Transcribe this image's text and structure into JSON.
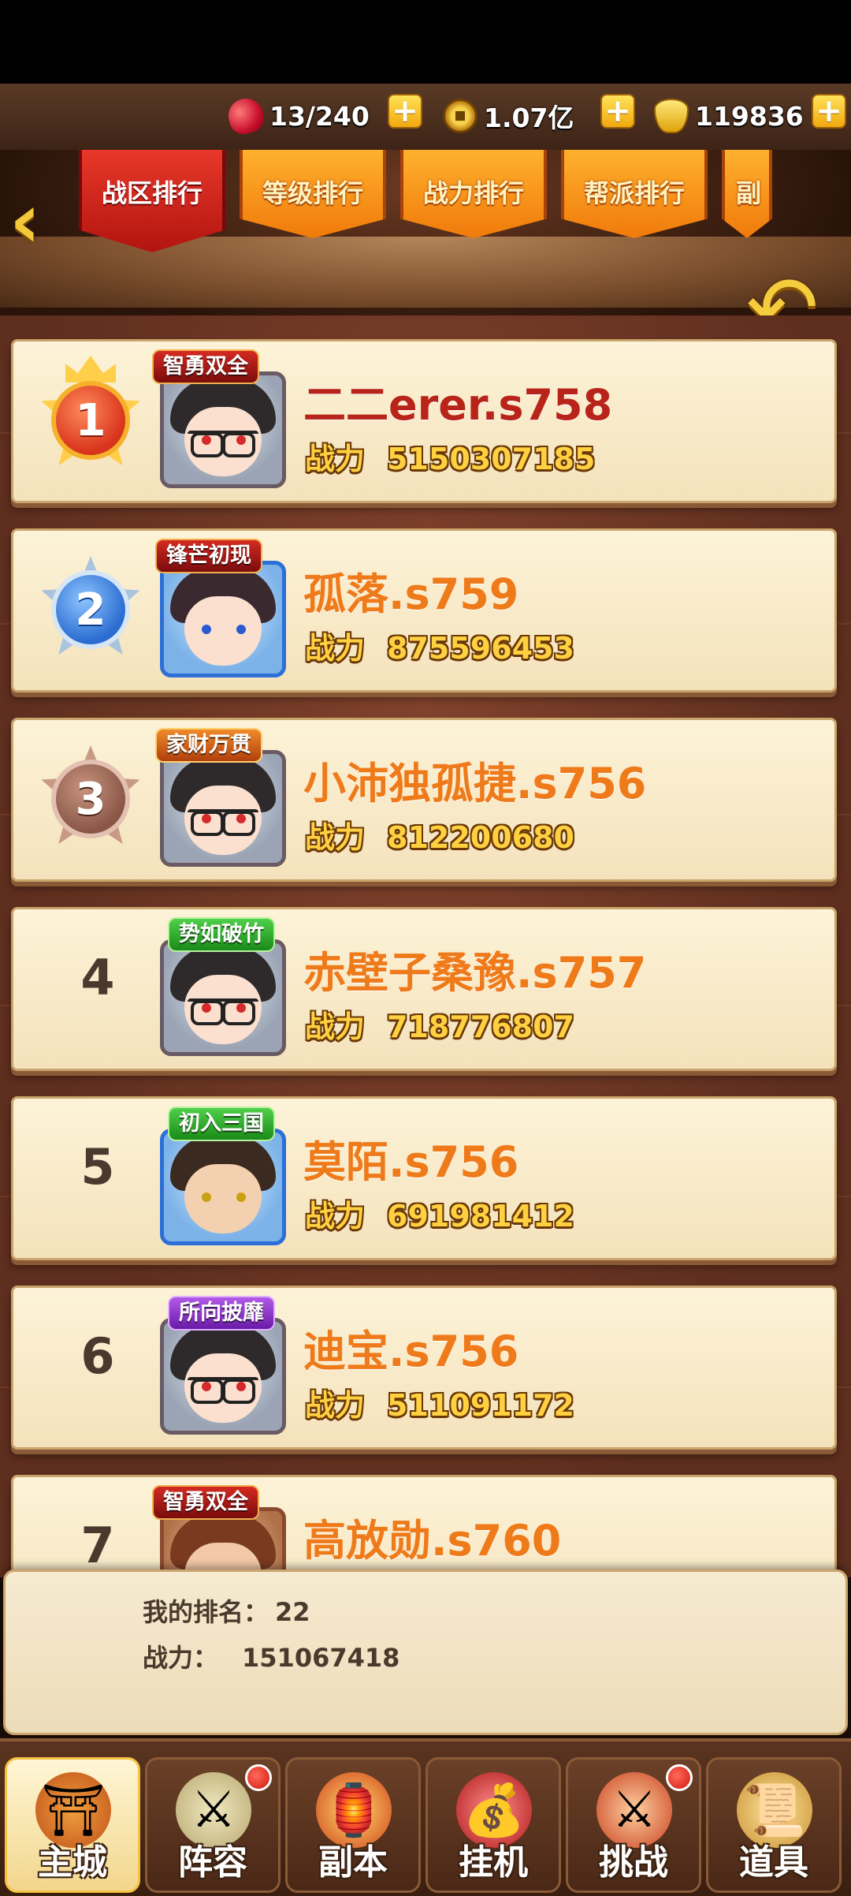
{
  "resources": {
    "stamina": "13/240",
    "copper": "1.07亿",
    "ingot": "119836"
  },
  "tabs": [
    {
      "label": "战区排行",
      "active": true
    },
    {
      "label": "等级排行",
      "active": false
    },
    {
      "label": "战力排行",
      "active": false
    },
    {
      "label": "帮派排行",
      "active": false
    },
    {
      "label": "副",
      "active": false
    }
  ],
  "power_label": "战力",
  "rankings": [
    {
      "rank": "1",
      "title": "智勇双全",
      "name": "二二erer.s758",
      "power": "5150307185"
    },
    {
      "rank": "2",
      "title": "锋芒初现",
      "name": "孤落.s759",
      "power": "875596453"
    },
    {
      "rank": "3",
      "title": "家财万贯",
      "name": "小沛独孤捷.s756",
      "power": "812200680"
    },
    {
      "rank": "4",
      "title": "势如破竹",
      "name": "赤壁子桑豫.s757",
      "power": "718776807"
    },
    {
      "rank": "5",
      "title": "初入三国",
      "name": "莫陌.s756",
      "power": "691981412"
    },
    {
      "rank": "6",
      "title": "所向披靡",
      "name": "迪宝.s756",
      "power": "511091172"
    },
    {
      "rank": "7",
      "title": "智勇双全",
      "name": "高放勋.s760",
      "power": ""
    }
  ],
  "my_rank": {
    "rank_label": "我的排名：",
    "rank_value": "22",
    "power_label": "战力：",
    "power_value": "151067418"
  },
  "bottom_nav": [
    {
      "label": "主城",
      "active": true,
      "badge": false
    },
    {
      "label": "阵容",
      "active": false,
      "badge": true
    },
    {
      "label": "副本",
      "active": false,
      "badge": false
    },
    {
      "label": "挂机",
      "active": false,
      "badge": false
    },
    {
      "label": "挑战",
      "active": false,
      "badge": true
    },
    {
      "label": "道具",
      "active": false,
      "badge": false
    }
  ]
}
